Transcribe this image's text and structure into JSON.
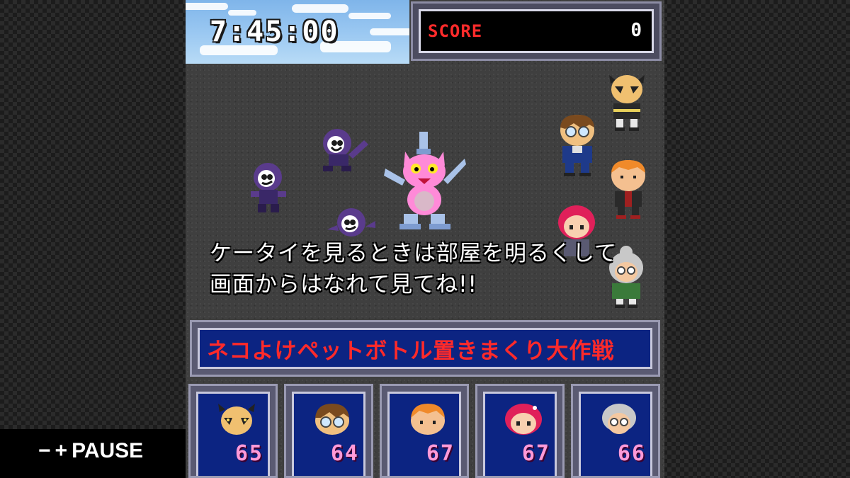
{
  "hud": {
    "timer": "7:45:00",
    "score_label": "SCORE",
    "score_value": "0"
  },
  "dialogue": {
    "line1": "ケータイを見るときは部屋を明るくして",
    "line2": "画面からはなれて見てね!!"
  },
  "mission": {
    "title": "ネコよけペットボトル置きまくり大作戦"
  },
  "party": [
    {
      "icon": "bald-boy-face-icon",
      "hp": "65"
    },
    {
      "icon": "glasses-boy-face-icon",
      "hp": "64"
    },
    {
      "icon": "orange-hair-boy-face-icon",
      "hp": "67"
    },
    {
      "icon": "red-hair-girl-face-icon",
      "hp": "67"
    },
    {
      "icon": "grandma-face-icon",
      "hp": "66"
    }
  ],
  "controls": {
    "minus": "−",
    "plus": "+",
    "pause_label": "PAUSE"
  },
  "colors": {
    "score_label": "#ff2b2b",
    "mission_text": "#ff2a2a",
    "panel_blue": "#0c2482",
    "hp_text": "#ff9ad8"
  }
}
